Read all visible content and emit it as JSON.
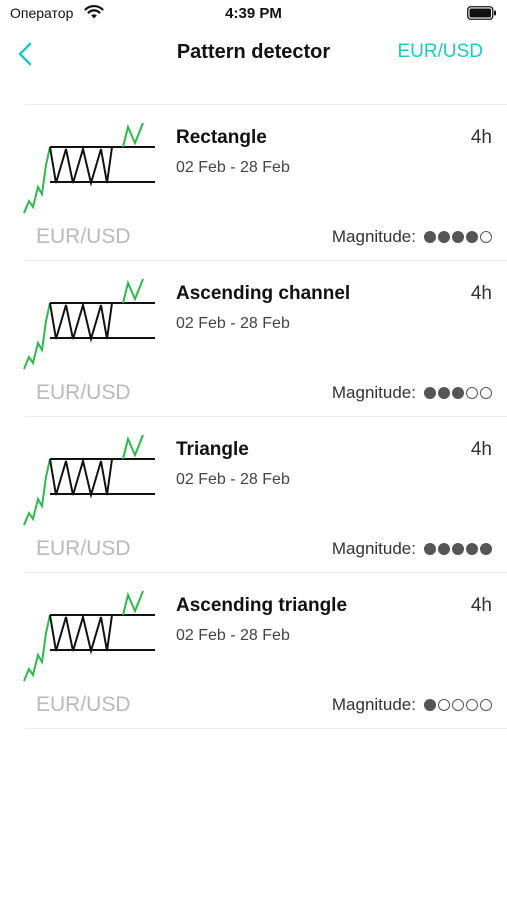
{
  "status_bar": {
    "carrier": "Оператор",
    "time": "4:39 PM"
  },
  "nav": {
    "title": "Pattern detector",
    "right_label": "EUR/USD",
    "back_icon": "chevron-left-icon",
    "accent_color": "#21c6c0"
  },
  "magnitude_label": "Magnitude:",
  "patterns": [
    {
      "title": "Rectangle",
      "timeframe": "4h",
      "dates": "02 Feb - 28 Feb",
      "pair": "EUR/USD",
      "magnitude": 4,
      "max": 5
    },
    {
      "title": "Ascending channel",
      "timeframe": "4h",
      "dates": "02 Feb - 28 Feb",
      "pair": "EUR/USD",
      "magnitude": 3,
      "max": 5
    },
    {
      "title": "Triangle",
      "timeframe": "4h",
      "dates": "02 Feb - 28 Feb",
      "pair": "EUR/USD",
      "magnitude": 5,
      "max": 5
    },
    {
      "title": "Ascending triangle",
      "timeframe": "4h",
      "dates": "02 Feb - 28 Feb",
      "pair": "EUR/USD",
      "magnitude": 1,
      "max": 5
    }
  ]
}
